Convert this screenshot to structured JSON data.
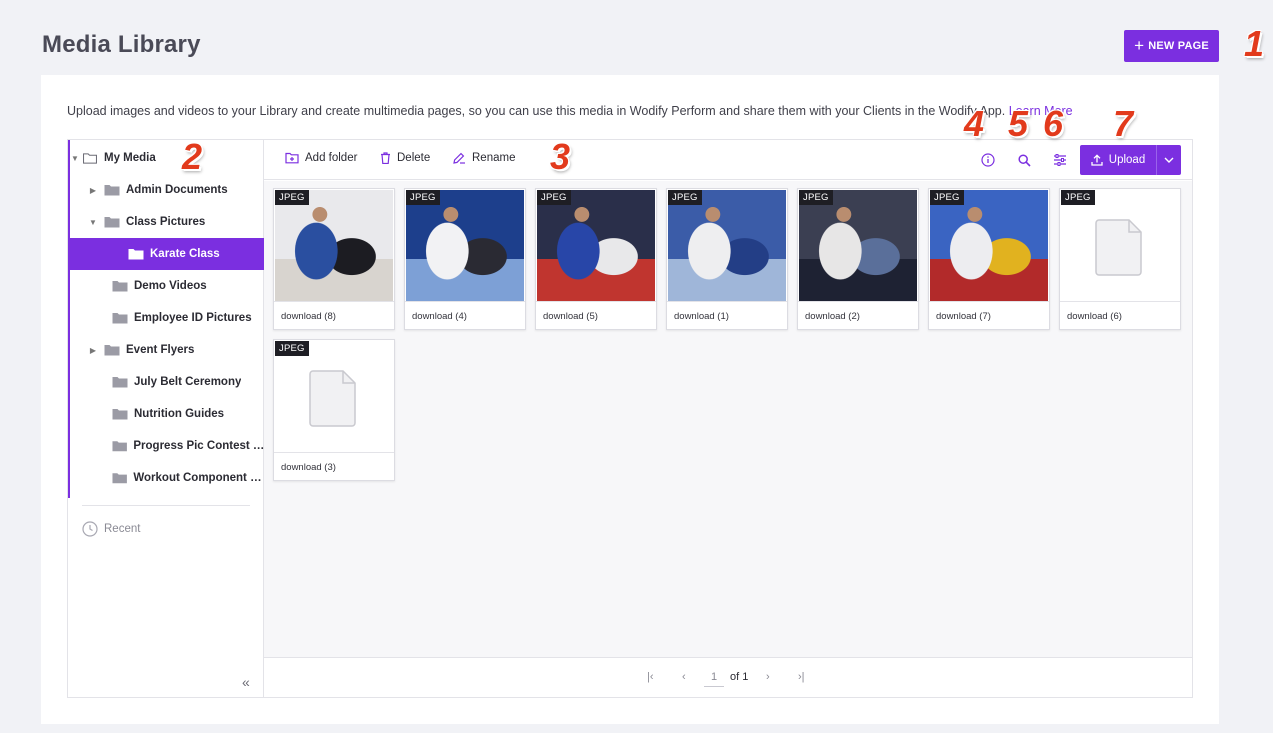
{
  "header": {
    "title": "Media Library",
    "new_page_label": "NEW PAGE"
  },
  "annotations": [
    "1",
    "2",
    "3",
    "4",
    "5",
    "6",
    "7"
  ],
  "intro": {
    "text": "Upload images and videos to your Library and create multimedia pages, so you can use this media in Wodify Perform and share them with your Clients in the Wodify App.",
    "link": "Learn More"
  },
  "tree": {
    "root": "My Media",
    "items": [
      {
        "label": "Admin Documents",
        "caret": "right"
      },
      {
        "label": "Class Pictures",
        "caret": "down"
      },
      {
        "label": "Karate Class",
        "caret": "",
        "selected": true
      },
      {
        "label": "Demo Videos",
        "caret": ""
      },
      {
        "label": "Employee ID Pictures",
        "caret": ""
      },
      {
        "label": "Event Flyers",
        "caret": "right"
      },
      {
        "label": "July Belt Ceremony",
        "caret": ""
      },
      {
        "label": "Nutrition Guides",
        "caret": ""
      },
      {
        "label": "Progress Pic Contest S...",
        "caret": ""
      },
      {
        "label": "Workout Component Vi...",
        "caret": ""
      }
    ],
    "recent_label": "Recent",
    "collapse_icon": "«"
  },
  "toolbar": {
    "add_folder": "Add folder",
    "delete": "Delete",
    "rename": "Rename",
    "upload": "Upload",
    "icons": [
      "info-icon",
      "search-icon",
      "filter-settings-icon"
    ]
  },
  "files": [
    {
      "badge": "JPEG",
      "name": "download (8)",
      "thumb": "photo"
    },
    {
      "badge": "JPEG",
      "name": "download (4)",
      "thumb": "photo"
    },
    {
      "badge": "JPEG",
      "name": "download (5)",
      "thumb": "photo"
    },
    {
      "badge": "JPEG",
      "name": "download (1)",
      "thumb": "photo"
    },
    {
      "badge": "JPEG",
      "name": "download (2)",
      "thumb": "photo"
    },
    {
      "badge": "JPEG",
      "name": "download (7)",
      "thumb": "photo"
    },
    {
      "badge": "JPEG",
      "name": "download (6)",
      "thumb": "placeholder"
    },
    {
      "badge": "JPEG",
      "name": "download (3)",
      "thumb": "placeholder"
    }
  ],
  "pagination": {
    "page": "1",
    "of": "of 1"
  },
  "colors": {
    "accent": "#7b2fe0",
    "annotation": "#e23a1c"
  }
}
